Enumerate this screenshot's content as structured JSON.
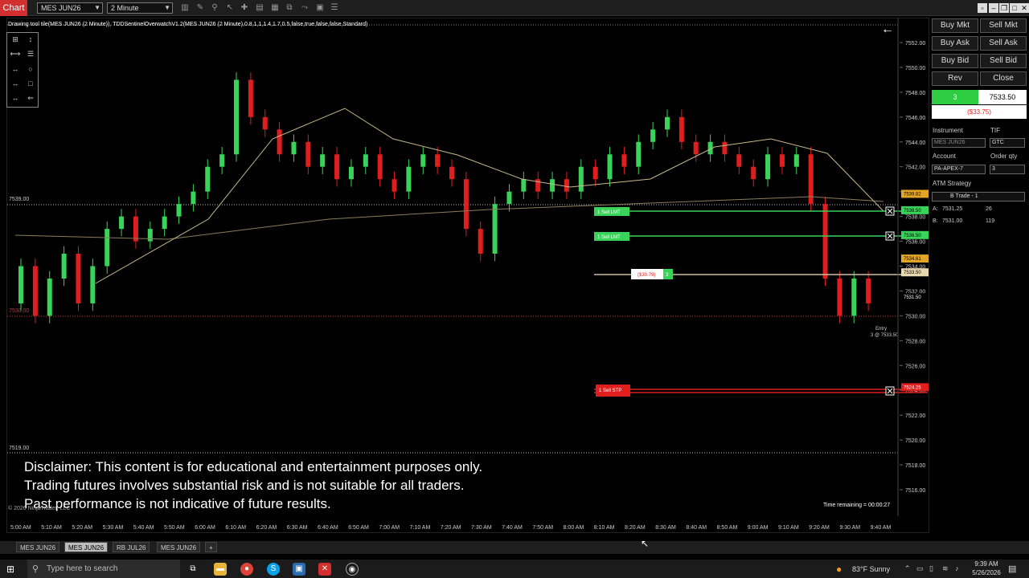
{
  "app": {
    "tab_label": "Chart"
  },
  "toolbar": {
    "instrument": "MES JUN26",
    "interval": "2 Minute"
  },
  "chart": {
    "indicator_title": "Drawing tool tile(MES JUN26 (2 Minute)), TDDSentinelOverwatchV1.2(MES JUN26 (2 Minute),0.8,1,1,1.4,1.7,0.5,false,true,false,false,Standard)",
    "level_label_top": "7539.00",
    "level_label_mid": "7530.00",
    "level_label_bottom": "7519.00",
    "time_remaining": "Time remaining = 00:00:27",
    "copyright": "© 2026 NinjaTrader, LLC",
    "price_ticks": [
      "7552.00",
      "7550.00",
      "7548.00",
      "7546.00",
      "7544.00",
      "7542.00",
      "7540.00",
      "7538.00",
      "7536.00",
      "7534.00",
      "7532.00",
      "7530.00",
      "7528.00",
      "7526.00",
      "7524.00",
      "7522.00",
      "7520.00",
      "7518.00",
      "7516.00"
    ],
    "time_ticks": [
      "5:00 AM",
      "5:10 AM",
      "5:20 AM",
      "5:30 AM",
      "5:40 AM",
      "5:50 AM",
      "6:00 AM",
      "6:10 AM",
      "6:20 AM",
      "6:30 AM",
      "6:40 AM",
      "6:50 AM",
      "7:00 AM",
      "7:10 AM",
      "7:20 AM",
      "7:30 AM",
      "7:40 AM",
      "7:50 AM",
      "8:00 AM",
      "8:10 AM",
      "8:20 AM",
      "8:30 AM",
      "8:40 AM",
      "8:50 AM",
      "9:00 AM",
      "9:10 AM",
      "9:20 AM",
      "9:30 AM",
      "9:40 AM"
    ],
    "orders": {
      "sell_limit_1": "1  Sell LMT",
      "sell_limit_2": "1  Sell LMT",
      "position_pnl": "($30.79)",
      "position_qty": "3",
      "sell_stop": "1  Sell STP",
      "stop_price": "7524.25",
      "entry_label": "Entry",
      "entry_detail": "3 @ 7533.50"
    },
    "price_flags": {
      "gold_top": "7539.82",
      "limit_1": "7538.50",
      "limit_2": "7536.50",
      "gold_mid": "7534.61",
      "entry": "7533.50",
      "last": "7531.50"
    }
  },
  "disclaimer": {
    "line1": "Disclaimer: This content is for educational and entertainment purposes only.",
    "line2": "Trading futures involves substantial risk and is not suitable for all traders.",
    "line3": "Past performance is not indicative of future results."
  },
  "panel": {
    "buy_mkt": "Buy Mkt",
    "sell_mkt": "Sell Mkt",
    "buy_ask": "Buy Ask",
    "sell_ask": "Sell Ask",
    "buy_bid": "Buy Bid",
    "sell_bid": "Sell Bid",
    "rev": "Rev",
    "close": "Close",
    "position_qty": "3",
    "position_price": "7533.50",
    "position_pnl": "($33.75)",
    "instrument_label": "Instrument",
    "tif_label": "TIF",
    "instrument_value": "MES JUN26",
    "tif_value": "GTC",
    "account_label": "Account",
    "order_qty_label": "Order qty",
    "account_value": "PA-APEX-7",
    "order_qty_value": "3",
    "atm_label": "ATM Strategy",
    "atm_value": "B Trade - 1",
    "ask_label": "A:",
    "ask_price": "7531.25",
    "ask_size": "26",
    "bid_label": "B:",
    "bid_price": "7531.00",
    "bid_size": "119"
  },
  "tabs": [
    "MES JUN26",
    "MES JUN26",
    "RB JUL26",
    "MES JUN26"
  ],
  "taskbar": {
    "search_placeholder": "Type here to search",
    "weather": "83°F  Sunny",
    "time": "9:39 AM",
    "date": "5/26/2026"
  },
  "colors": {
    "up": "#39d35a",
    "down": "#e01e1e",
    "accent": "#d32f2f"
  }
}
